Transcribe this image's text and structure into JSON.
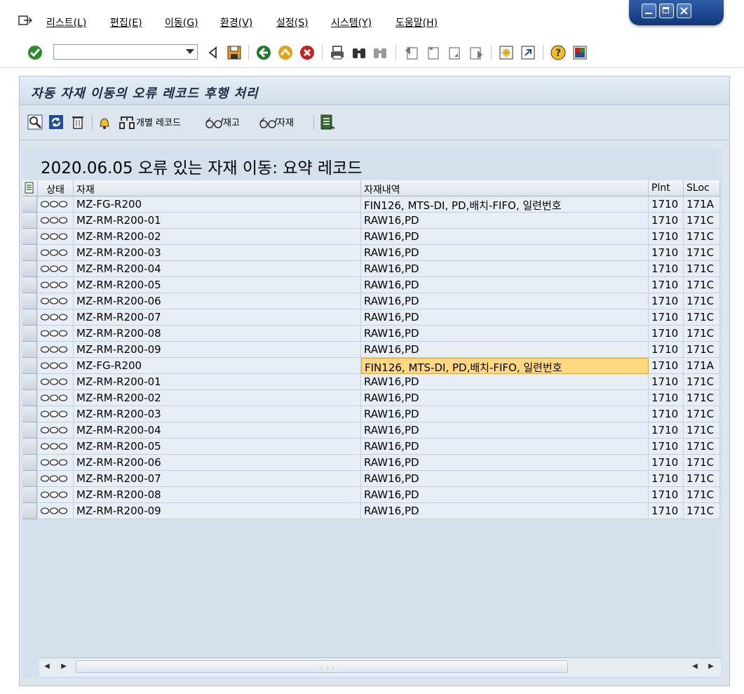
{
  "menu": {
    "items": [
      "리스트(L)",
      "편집(E)",
      "이동(G)",
      "환경(V)",
      "설정(S)",
      "시스템(Y)",
      "도움말(H)"
    ]
  },
  "toolbar": {
    "command_field": ""
  },
  "title": "자동 자재 이동의 오류 레코드 후행 처리",
  "app_toolbar": {
    "individual_records": "개별 레코드",
    "stock": "재고",
    "material": "자재"
  },
  "list": {
    "heading": "2020.06.05 오류 있는 자재 이동: 요약 레코드",
    "columns": [
      "상태",
      "자재",
      "자재내역",
      "Plnt",
      "SLoc"
    ],
    "rows": [
      {
        "material": "MZ-FG-R200",
        "desc": "FIN126, MTS-DI, PD,배치-FIFO, 일련번호",
        "plant": "1710",
        "sloc": "171A"
      },
      {
        "material": "MZ-RM-R200-01",
        "desc": "RAW16,PD",
        "plant": "1710",
        "sloc": "171C"
      },
      {
        "material": "MZ-RM-R200-02",
        "desc": "RAW16,PD",
        "plant": "1710",
        "sloc": "171C"
      },
      {
        "material": "MZ-RM-R200-03",
        "desc": "RAW16,PD",
        "plant": "1710",
        "sloc": "171C"
      },
      {
        "material": "MZ-RM-R200-04",
        "desc": "RAW16,PD",
        "plant": "1710",
        "sloc": "171C"
      },
      {
        "material": "MZ-RM-R200-05",
        "desc": "RAW16,PD",
        "plant": "1710",
        "sloc": "171C"
      },
      {
        "material": "MZ-RM-R200-06",
        "desc": "RAW16,PD",
        "plant": "1710",
        "sloc": "171C"
      },
      {
        "material": "MZ-RM-R200-07",
        "desc": "RAW16,PD",
        "plant": "1710",
        "sloc": "171C"
      },
      {
        "material": "MZ-RM-R200-08",
        "desc": "RAW16,PD",
        "plant": "1710",
        "sloc": "171C"
      },
      {
        "material": "MZ-RM-R200-09",
        "desc": "RAW16,PD",
        "plant": "1710",
        "sloc": "171C"
      },
      {
        "material": "MZ-FG-R200",
        "desc": "FIN126, MTS-DI, PD,배치-FIFO, 일련번호",
        "plant": "1710",
        "sloc": "171A",
        "selected": true
      },
      {
        "material": "MZ-RM-R200-01",
        "desc": "RAW16,PD",
        "plant": "1710",
        "sloc": "171C"
      },
      {
        "material": "MZ-RM-R200-02",
        "desc": "RAW16,PD",
        "plant": "1710",
        "sloc": "171C"
      },
      {
        "material": "MZ-RM-R200-03",
        "desc": "RAW16,PD",
        "plant": "1710",
        "sloc": "171C"
      },
      {
        "material": "MZ-RM-R200-04",
        "desc": "RAW16,PD",
        "plant": "1710",
        "sloc": "171C"
      },
      {
        "material": "MZ-RM-R200-05",
        "desc": "RAW16,PD",
        "plant": "1710",
        "sloc": "171C"
      },
      {
        "material": "MZ-RM-R200-06",
        "desc": "RAW16,PD",
        "plant": "1710",
        "sloc": "171C"
      },
      {
        "material": "MZ-RM-R200-07",
        "desc": "RAW16,PD",
        "plant": "1710",
        "sloc": "171C"
      },
      {
        "material": "MZ-RM-R200-08",
        "desc": "RAW16,PD",
        "plant": "1710",
        "sloc": "171C"
      },
      {
        "material": "MZ-RM-R200-09",
        "desc": "RAW16,PD",
        "plant": "1710",
        "sloc": "171C"
      }
    ]
  },
  "colors": {
    "highlight": "#ffd87f",
    "panel": "#dde6ef",
    "window_controls": "#2f5da8"
  }
}
